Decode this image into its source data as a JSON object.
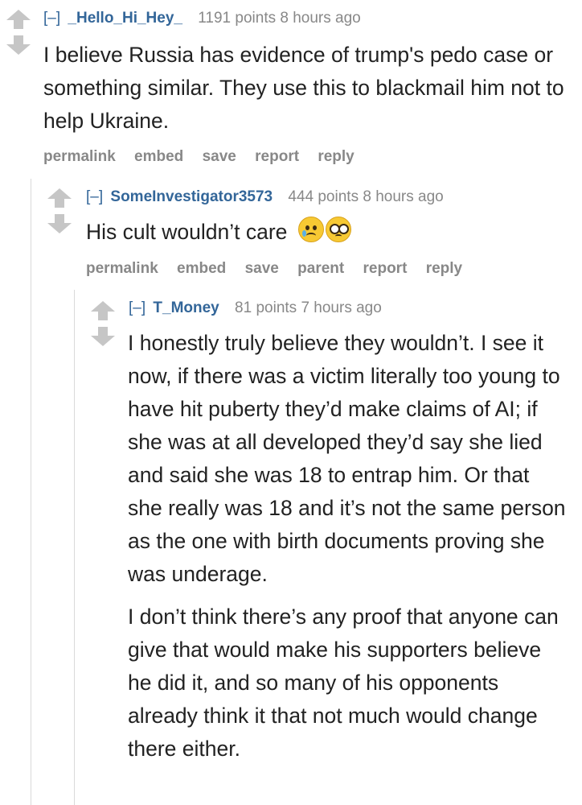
{
  "comments": [
    {
      "toggle": "[–]",
      "author": "_Hello_Hi_Hey_",
      "meta": "1191 points 8 hours ago",
      "body": [
        "I believe Russia has evidence of trump's pedo case or something similar. They use this to blackmail him not to help Ukraine."
      ],
      "buttons": [
        "permalink",
        "embed",
        "save",
        "report",
        "reply"
      ]
    },
    {
      "toggle": "[–]",
      "author": "SomeInvestigator3573",
      "meta": "444 points 8 hours ago",
      "body": [
        "His cult wouldn’t care"
      ],
      "emoji": [
        "crying-face",
        "pleading-face"
      ],
      "buttons": [
        "permalink",
        "embed",
        "save",
        "parent",
        "report",
        "reply"
      ]
    },
    {
      "toggle": "[–]",
      "author": "T_Money",
      "meta": "81 points 7 hours ago",
      "body": [
        "I honestly truly believe they wouldn’t. I see it now, if there was a victim literally too young to have hit puberty they’d make claims of AI; if she was at all developed they’d say she lied and said she was 18 to entrap him. Or that she really was 18 and it’s not the same person as the one with birth documents proving she was underage.",
        "I don’t think there’s any proof that anyone can give that would make his supporters believe he did it, and so many of his opponents already think it that not much would change there either."
      ]
    }
  ]
}
